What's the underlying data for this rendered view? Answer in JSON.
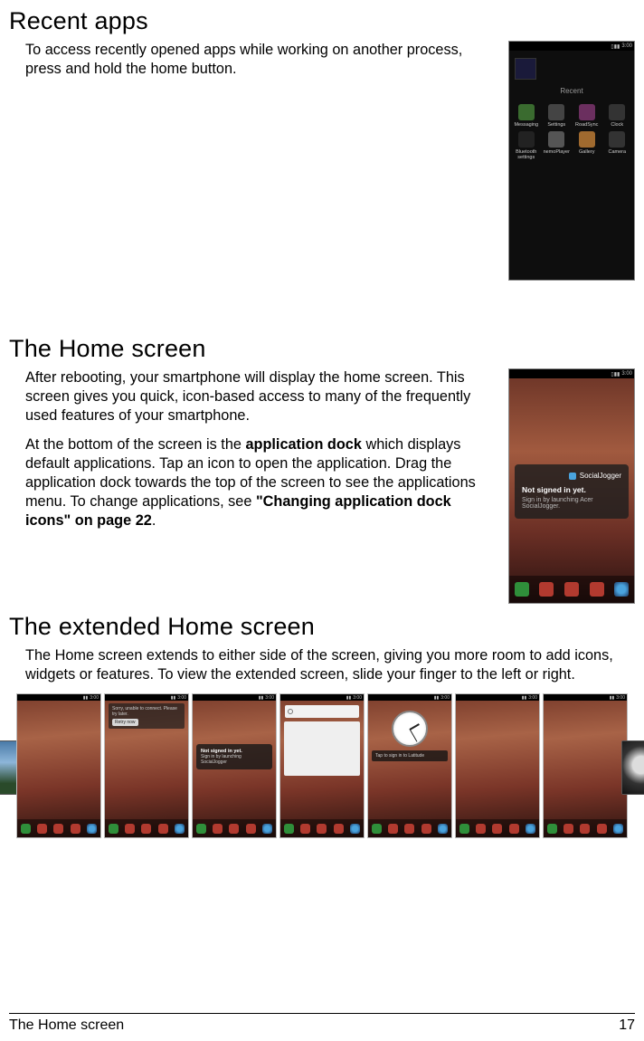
{
  "sections": {
    "recent_apps": {
      "heading": "Recent apps",
      "body": "To access recently opened apps while working on another process, press and hold the home button."
    },
    "home_screen": {
      "heading": "The Home screen",
      "body1": "After rebooting, your smartphone will display the home screen. This screen gives you quick, icon-based access to many of the frequently used features of your smartphone.",
      "body2_a": "At the bottom of the screen is the ",
      "body2_bold1": "application dock",
      "body2_b": " which displays default applications. Tap an icon to open the application. Drag the application dock towards the top of the screen to see the applications menu. To change applications, see ",
      "body2_bold2": "\"Changing application dock icons\" on page 22",
      "body2_c": "."
    },
    "extended": {
      "heading": "The extended Home screen",
      "body": "The Home screen extends to either side of the screen, giving you more room to add icons, widgets or features. To view the extended screen, slide your finger to the left or right."
    }
  },
  "recent_phone": {
    "status_time": "3:00",
    "label": "Recent",
    "apps": [
      {
        "name": "Messaging"
      },
      {
        "name": "Settings"
      },
      {
        "name": "RoadSync"
      },
      {
        "name": "Clock"
      },
      {
        "name": "Bluetooth settings"
      },
      {
        "name": "nemoPlayer"
      },
      {
        "name": "Gallery"
      },
      {
        "name": "Camera"
      }
    ]
  },
  "home_phone": {
    "status_time": "3:00",
    "widget_brand": "SocialJogger",
    "widget_title": "Not signed in yet.",
    "widget_sub": "Sign in by launching Acer SocialJogger."
  },
  "mini_widgets": {
    "retry_msg": "Sorry, unable to connect. Please try later.",
    "retry_btn": "Retry now",
    "signed_title": "Not signed in yet.",
    "signed_sub": "Sign in by launching SocialJogger",
    "tap_msg": "Tap to sign in to Latitude"
  },
  "footer": {
    "title": "The Home screen",
    "page": "17"
  }
}
